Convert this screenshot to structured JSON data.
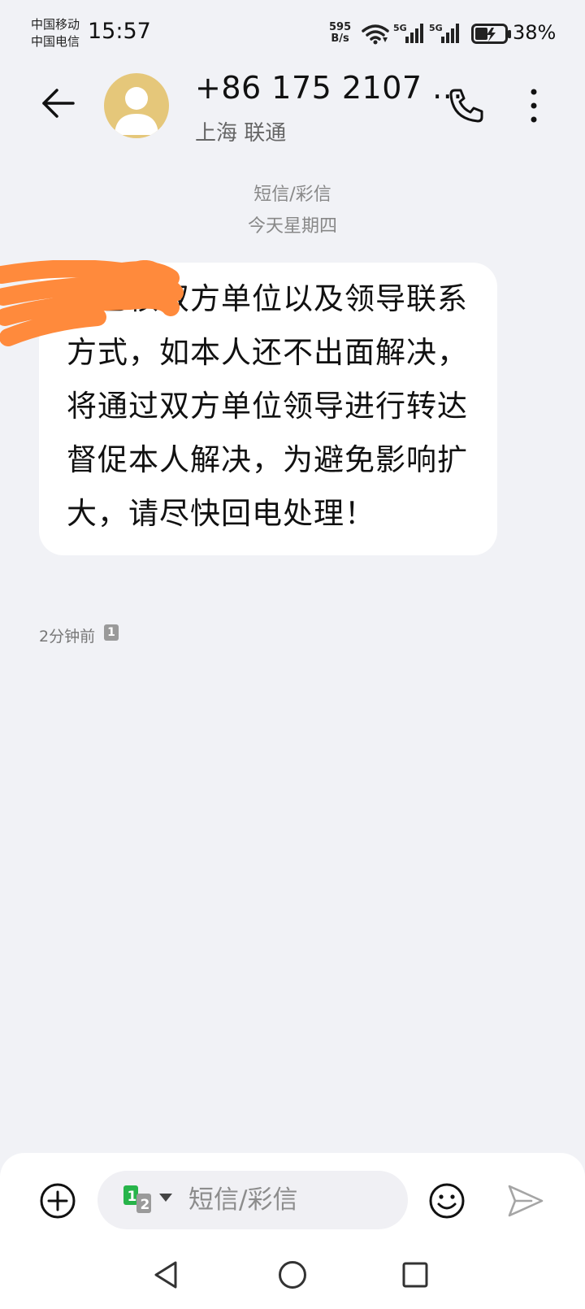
{
  "status_bar": {
    "carrier_1": "中国移动",
    "carrier_2": "中国电信",
    "time": "15:57",
    "net_speed_value": "595",
    "net_speed_unit": "B/s",
    "signal_1_label": "5G",
    "signal_2_label": "5G",
    "battery": "38%",
    "icons": [
      "wifi-icon",
      "signal-icon",
      "signal-icon",
      "battery-charging-icon"
    ]
  },
  "header": {
    "contact_name": "+86 175 2107 ...",
    "contact_location": "上海 联通",
    "icons": [
      "back-arrow-icon",
      "person-icon",
      "phone-icon",
      "more-vertical-icon"
    ]
  },
  "conversation": {
    "message_type": "短信/彩信",
    "day": "今天星期四",
    "messages": [
      {
        "text": "，已核双方单位以及领导联系方式，如本人还不出面解决，将通过双方单位领导进行转达督促本人解决，为避免影响扩大，请尽快回电处理！",
        "time": "2分钟前",
        "sim": "1"
      }
    ]
  },
  "composer": {
    "placeholder": "短信/彩信",
    "sim_primary": "1",
    "sim_secondary": "2",
    "icons": [
      "add-circle-icon",
      "sim-select-icon",
      "emoji-icon",
      "send-icon"
    ]
  },
  "nav_bar": {
    "icons": [
      "nav-back-icon",
      "nav-home-icon",
      "nav-recent-icon"
    ]
  },
  "colors": {
    "background": "#f1f2f6",
    "bubble": "#ffffff",
    "avatar": "#e5c77a",
    "redaction": "#ff8a3c",
    "sim_1": "#27b44a"
  }
}
